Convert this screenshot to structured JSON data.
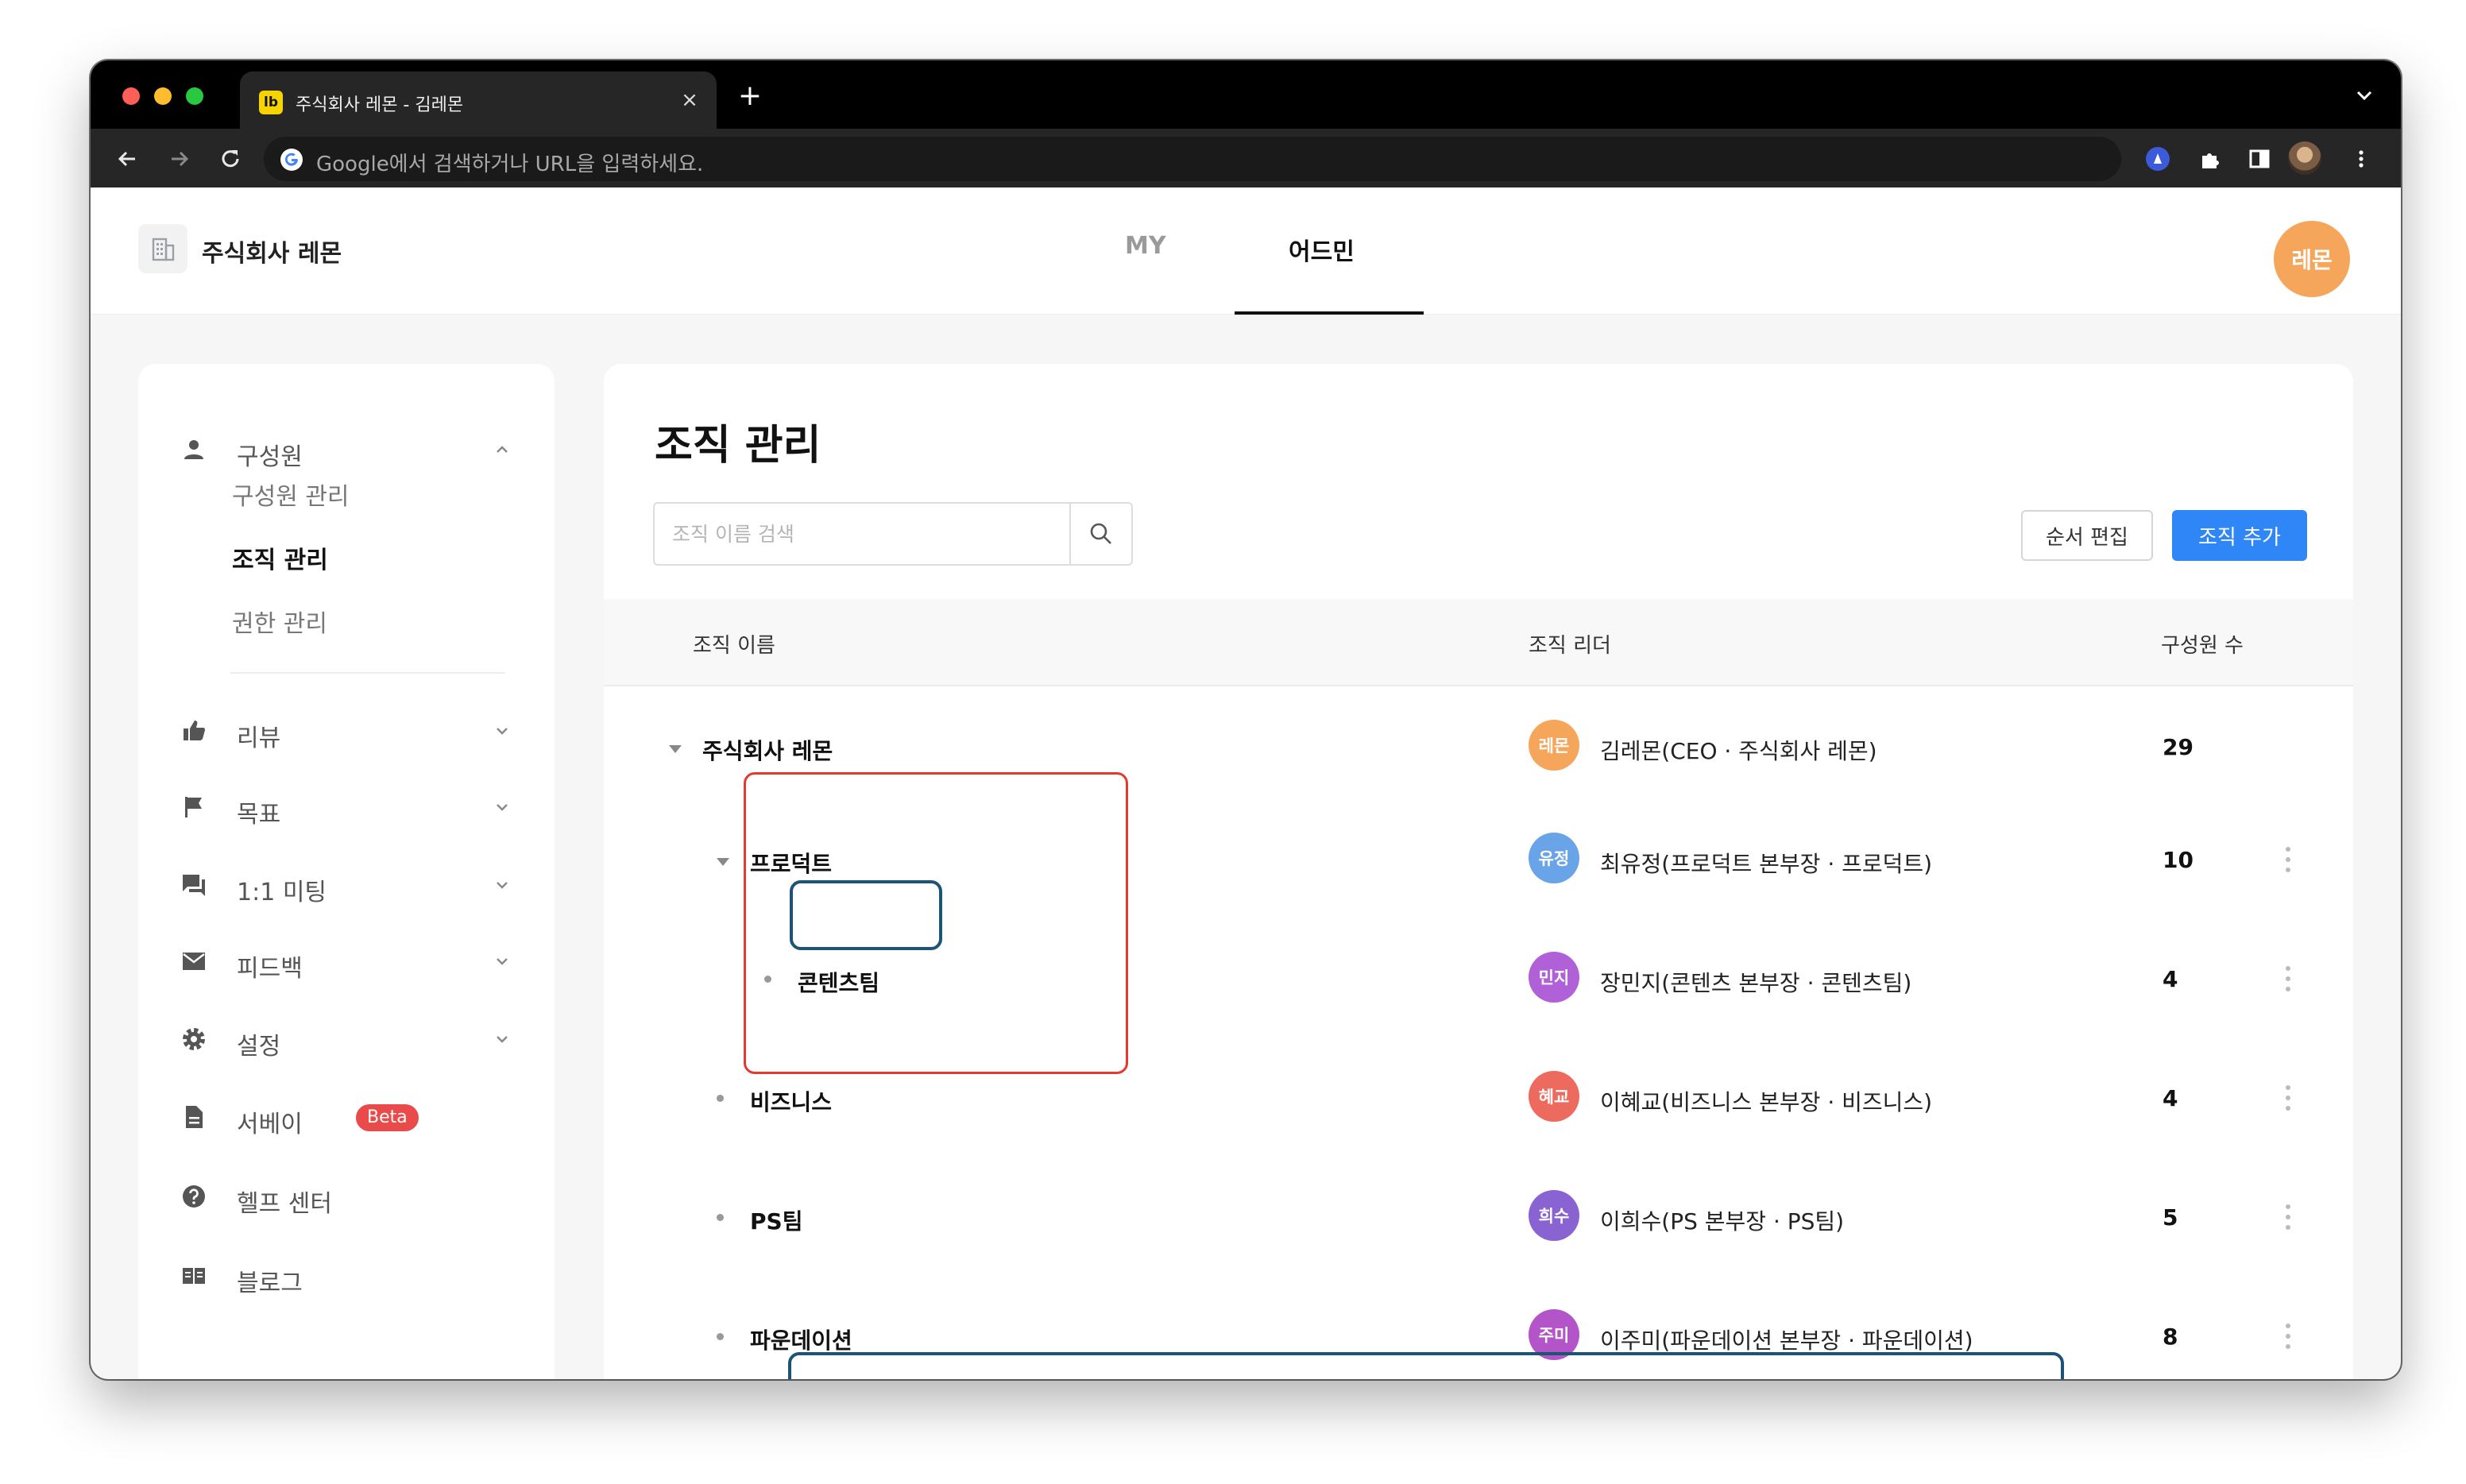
{
  "browser": {
    "tab_title": "주식회사 레몬 - 김레몬",
    "favicon_text": "lb",
    "close_glyph": "×",
    "new_tab_glyph": "+",
    "omnibox_placeholder": "Google에서 검색하거나 URL을 입력하세요."
  },
  "header": {
    "company_name": "주식회사 레몬",
    "tabs": [
      {
        "label": "MY",
        "active": false
      },
      {
        "label": "어드민",
        "active": true
      }
    ],
    "avatar_text": "레몬",
    "avatar_color": "#f5a65b"
  },
  "sidebar": {
    "sections": [
      {
        "label": "구성원",
        "icon": "person-icon",
        "expanded": true
      },
      {
        "label": "리뷰",
        "icon": "thumbs-up-icon"
      },
      {
        "label": "목표",
        "icon": "flag-icon"
      },
      {
        "label": "1:1 미팅",
        "icon": "chat-icon"
      },
      {
        "label": "피드백",
        "icon": "mail-icon"
      },
      {
        "label": "설정",
        "icon": "gear-icon"
      },
      {
        "label": "서베이",
        "icon": "document-icon",
        "badge": "Beta"
      },
      {
        "label": "헬프 센터",
        "icon": "help-icon"
      },
      {
        "label": "블로그",
        "icon": "book-icon"
      }
    ],
    "sub_items": [
      {
        "label": "구성원 관리",
        "active": false
      },
      {
        "label": "조직 관리",
        "active": true
      },
      {
        "label": "권한 관리",
        "active": false
      }
    ]
  },
  "main": {
    "title": "조직 관리",
    "search_placeholder": "조직 이름 검색",
    "btn_order_edit": "순서 편집",
    "btn_add_org": "조직 추가",
    "columns": {
      "name": "조직 이름",
      "leader": "조직 리더",
      "members": "구성원 수"
    },
    "rows": [
      {
        "name": "주식회사 레몬",
        "avatar": "레몬",
        "avatar_color": "#f5a65b",
        "leader": "김레몬(CEO · 주식회사 레몬)",
        "count": "29"
      },
      {
        "name": "프로덕트",
        "avatar": "유정",
        "avatar_color": "#6aa4e8",
        "leader": "최유정(프로덕트 본부장 · 프로덕트)",
        "count": "10"
      },
      {
        "name": "콘텐츠팀",
        "avatar": "민지",
        "avatar_color": "#b161d8",
        "leader": "장민지(콘텐츠 본부장 · 콘텐츠팀)",
        "count": "4"
      },
      {
        "name": "비즈니스",
        "avatar": "혜교",
        "avatar_color": "#ec6a5e",
        "leader": "이혜교(비즈니스 본부장 · 비즈니스)",
        "count": "4"
      },
      {
        "name": "PS팀",
        "avatar": "희수",
        "avatar_color": "#8a63d2",
        "leader": "이희수(PS 본부장 · PS팀)",
        "count": "5"
      },
      {
        "name": "파운데이션",
        "avatar": "주미",
        "avatar_color": "#b355c9",
        "leader": "이주미(파운데이션 본부장 · 파운데이션)",
        "count": "8"
      }
    ]
  }
}
